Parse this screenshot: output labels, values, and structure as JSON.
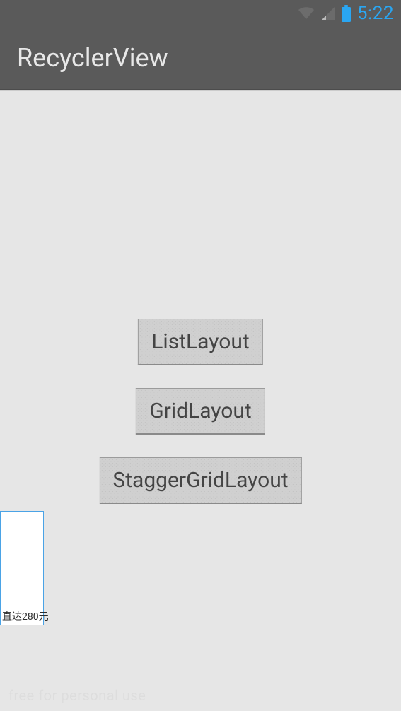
{
  "status_bar": {
    "time": "5:22",
    "battery_color": "#2aa6f2",
    "wifi_level": 0,
    "signal_level": 1
  },
  "action_bar": {
    "title": "RecyclerView"
  },
  "buttons": {
    "list": "ListLayout",
    "grid": "GridLayout",
    "stagger": "StaggerGridLayout"
  },
  "overlay": {
    "text": "直达280元"
  },
  "watermark": {
    "text": "free for personal use"
  }
}
